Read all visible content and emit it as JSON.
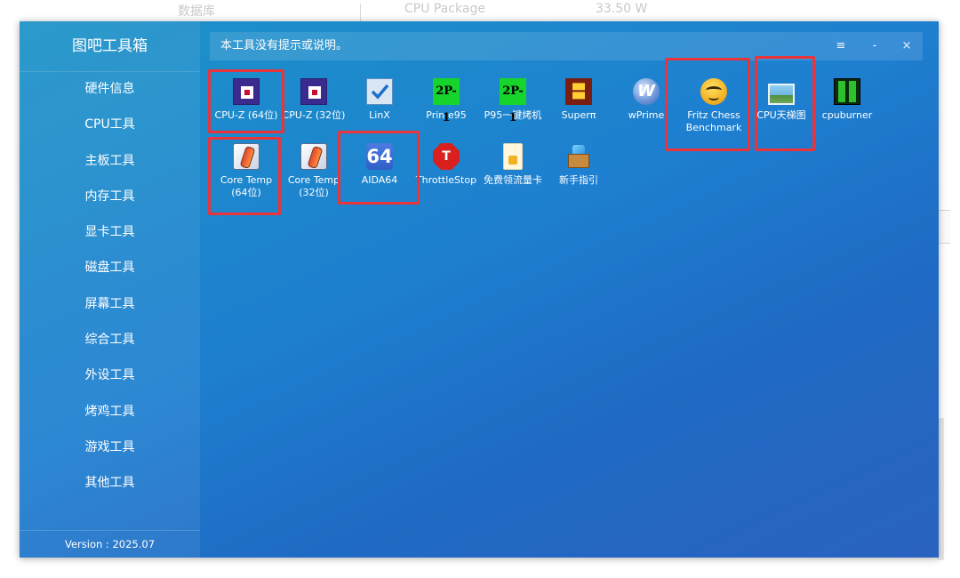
{
  "background": {
    "text_left": "数据库",
    "text_mid": "CPU Package",
    "text_right": "33.50 W"
  },
  "app": {
    "title": "图吧工具箱",
    "version": "Version : 2025.07",
    "hint": "本工具没有提示或说明。",
    "controls": {
      "menu": "≡",
      "minimize": "-",
      "close": "×"
    }
  },
  "sidebar": {
    "items": [
      {
        "label": "硬件信息"
      },
      {
        "label": "CPU工具"
      },
      {
        "label": "主板工具"
      },
      {
        "label": "内存工具"
      },
      {
        "label": "显卡工具"
      },
      {
        "label": "磁盘工具"
      },
      {
        "label": "屏幕工具"
      },
      {
        "label": "综合工具"
      },
      {
        "label": "外设工具"
      },
      {
        "label": "烤鸡工具"
      },
      {
        "label": "游戏工具"
      },
      {
        "label": "其他工具"
      }
    ]
  },
  "tools": [
    {
      "label": "CPU-Z (64位)",
      "icon": "cpu-chip-icon",
      "highlighted": true
    },
    {
      "label": "CPU-Z (32位)",
      "icon": "cpu-chip-icon",
      "highlighted": false
    },
    {
      "label": "LinX",
      "icon": "checkbox-icon",
      "highlighted": false
    },
    {
      "label": "Prime95",
      "icon": "prime-formula-icon",
      "highlighted": false
    },
    {
      "label": "P95一键烤机",
      "icon": "prime-formula-icon",
      "highlighted": false
    },
    {
      "label": "Superπ",
      "icon": "super-pi-icon",
      "highlighted": false
    },
    {
      "label": "wPrime",
      "icon": "wprime-orb-icon",
      "highlighted": false
    },
    {
      "label": "Fritz Chess",
      "label2": "Benchmark",
      "icon": "smiley-face-icon",
      "highlighted": true
    },
    {
      "label": "CPU天梯图",
      "icon": "landscape-picture-icon",
      "highlighted": true
    },
    {
      "label": "cpuburner",
      "icon": "green-bars-icon",
      "highlighted": false
    },
    {
      "label": "Core Temp",
      "label2": "(64位)",
      "icon": "thermometer-icon",
      "highlighted": true
    },
    {
      "label": "Core Temp",
      "label2": "(32位)",
      "icon": "thermometer-icon",
      "highlighted": false
    },
    {
      "label": "AIDA64",
      "icon": "aida64-icon",
      "icon_text": "64",
      "highlighted": true
    },
    {
      "label": "ThrottleStop",
      "icon": "stop-sign-icon",
      "icon_text": "T",
      "highlighted": false
    },
    {
      "label": "免费领流量卡",
      "icon": "sim-card-icon",
      "highlighted": false
    },
    {
      "label": "新手指引",
      "icon": "gift-box-icon",
      "highlighted": false
    }
  ],
  "icon_text": {
    "prime": "2P-1"
  },
  "colors": {
    "highlight": "#e8343a",
    "app_gradient_start": "#1b93c8",
    "app_gradient_end": "#2a62c0"
  }
}
